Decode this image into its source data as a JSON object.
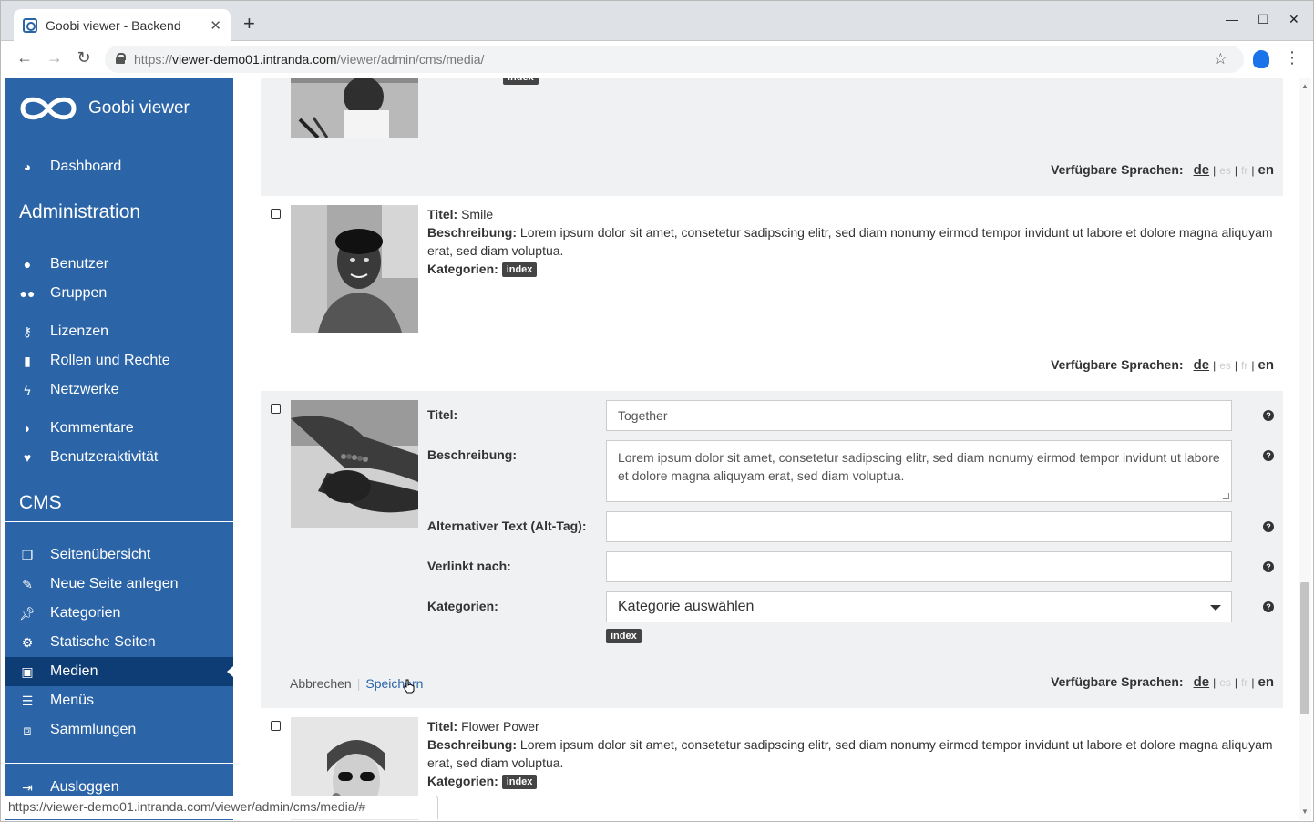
{
  "browser": {
    "tab_title": "Goobi viewer - Backend",
    "tab_close": "✕",
    "new_tab": "+",
    "url_scheme": "https://",
    "url_host": "viewer-demo01.intranda.com",
    "url_path": "/viewer/admin/cms/media/",
    "status_url": "https://viewer-demo01.intranda.com/viewer/admin/cms/media/#"
  },
  "sidebar": {
    "logo_text": "Goobi viewer",
    "dashboard": "Dashboard",
    "admin_heading": "Administration",
    "admin_items": [
      {
        "label": "Benutzer",
        "icon": "user-icon"
      },
      {
        "label": "Gruppen",
        "icon": "users-icon"
      },
      {
        "label": "Lizenzen",
        "icon": "key-icon"
      },
      {
        "label": "Rollen und Rechte",
        "icon": "lock-icon"
      },
      {
        "label": "Netzwerke",
        "icon": "bolt-icon"
      },
      {
        "label": "Kommentare",
        "icon": "comments-icon"
      },
      {
        "label": "Benutzeraktivität",
        "icon": "heartbeat-icon"
      }
    ],
    "cms_heading": "CMS",
    "cms_items": [
      {
        "label": "Seitenübersicht",
        "icon": "copy-icon"
      },
      {
        "label": "Neue Seite anlegen",
        "icon": "edit-icon"
      },
      {
        "label": "Kategorien",
        "icon": "thumbtack-icon"
      },
      {
        "label": "Statische Seiten",
        "icon": "cogs-icon"
      },
      {
        "label": "Medien",
        "icon": "image-icon",
        "active": true
      },
      {
        "label": "Menüs",
        "icon": "bars-icon"
      },
      {
        "label": "Sammlungen",
        "icon": "object-group-icon"
      }
    ],
    "logout": "Ausloggen"
  },
  "labels": {
    "title": "Titel:",
    "description": "Beschreibung:",
    "categories": "Kategorien:",
    "alt_text": "Alternativer Text (Alt-Tag):",
    "linked_to": "Verlinkt nach:",
    "available_langs": "Verfügbare Sprachen:",
    "lang_de": "de",
    "lang_es": "es",
    "lang_fr": "fr",
    "lang_en": "en",
    "sep": "|",
    "cancel": "Abbrechen",
    "save": "Speichern",
    "help": "?"
  },
  "media_items": [
    {
      "title": "Smile",
      "description": "Lorem ipsum dolor sit amet, consetetur sadipscing elitr, sed diam nonumy eirmod tempor invidunt ut labore et dolore magna aliquyam erat, sed diam voluptua.",
      "category_tag": "index"
    },
    {
      "editing": true,
      "title_value": "Together",
      "description_value": "Lorem ipsum dolor sit amet, consetetur sadipscing elitr, sed diam nonumy eirmod tempor invidunt ut labore et dolore magna aliquyam erat, sed diam voluptua.",
      "alt_value": "",
      "link_value": "",
      "category_select": "Kategorie auswählen",
      "category_tag": "index"
    },
    {
      "title": "Flower Power",
      "description": "Lorem ipsum dolor sit amet, consetetur sadipscing elitr, sed diam nonumy eirmod tempor invidunt ut labore et dolore magna aliquyam erat, sed diam voluptua.",
      "category_tag": "index"
    }
  ]
}
